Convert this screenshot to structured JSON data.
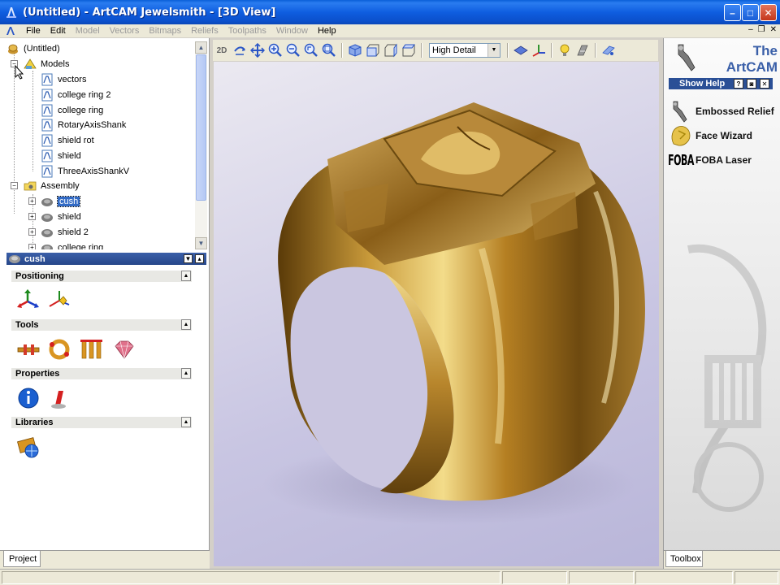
{
  "window": {
    "title": "(Untitled) - ArtCAM Jewelsmith - [3D View]",
    "minimize_glyph": "–",
    "maximize_glyph": "□",
    "close_glyph": "✕"
  },
  "menu": {
    "items": [
      {
        "label": "File",
        "enabled": true
      },
      {
        "label": "Edit",
        "enabled": true
      },
      {
        "label": "Model",
        "enabled": false
      },
      {
        "label": "Vectors",
        "enabled": false
      },
      {
        "label": "Bitmaps",
        "enabled": false
      },
      {
        "label": "Reliefs",
        "enabled": false
      },
      {
        "label": "Toolpaths",
        "enabled": false
      },
      {
        "label": "Window",
        "enabled": false
      },
      {
        "label": "Help",
        "enabled": true
      }
    ],
    "mdi_minimize": "–",
    "mdi_restore": "❐",
    "mdi_close": "✕"
  },
  "project_tree": {
    "root": "(Untitled)",
    "models_label": "Models",
    "models": [
      "vectors",
      "college ring 2",
      "college ring",
      "RotaryAxisShank",
      "shield rot",
      "shield",
      "ThreeAxisShankV"
    ],
    "assembly_label": "Assembly",
    "assembly": [
      "cush",
      "shield",
      "shield 2",
      "college ring"
    ],
    "selected": "cush"
  },
  "assembly_panel": {
    "title": "cush",
    "sections": [
      "Positioning",
      "Tools",
      "Properties",
      "Libraries"
    ]
  },
  "panel_tabs": {
    "project": "Project",
    "toolbox": "Toolbox"
  },
  "toolbar": {
    "view_2d_label": "2D",
    "detail_level": "High Detail"
  },
  "toolbox": {
    "logo_line1": "The",
    "logo_line2": "ArtCAM",
    "show_help": "Show Help",
    "help_glyph": "?",
    "items": [
      "Embossed Relief",
      "Face Wizard",
      "FOBA Laser"
    ],
    "foba_logo": "FOBA"
  },
  "colors": {
    "titlebar": "#0b4fca",
    "selection": "#316ac5",
    "panel_header": "#27478a",
    "gold": "#c9a043"
  }
}
